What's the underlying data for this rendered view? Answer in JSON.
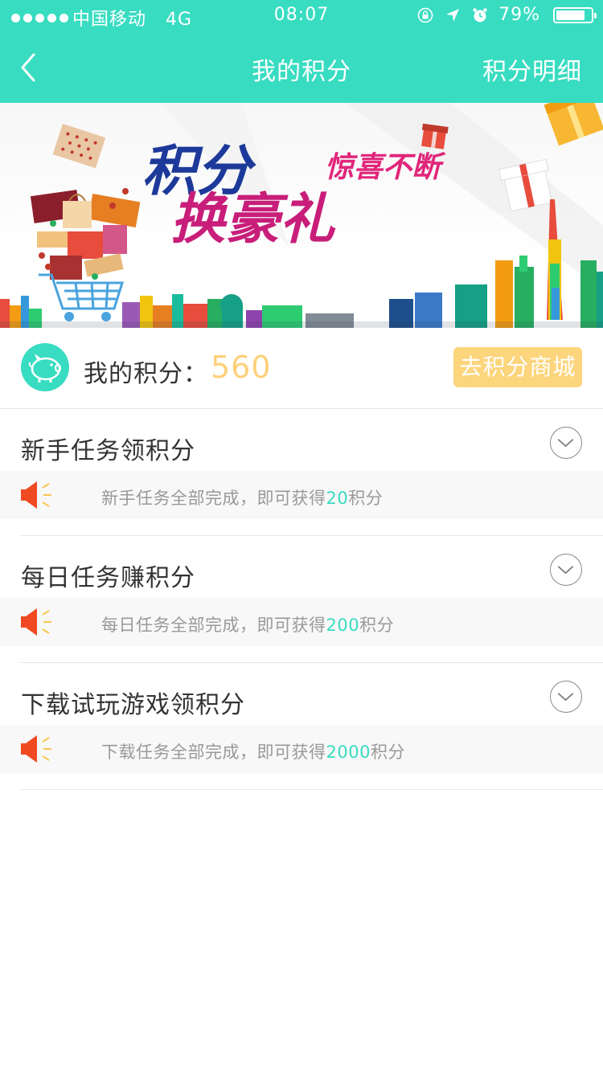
{
  "status_bar": {
    "carrier": "中国移动",
    "network": "4G",
    "time": "08:07",
    "battery": "79%",
    "icons": [
      "signal-dots-icon",
      "rotation-lock-icon",
      "location-arrow-icon",
      "alarm-icon",
      "battery-icon"
    ]
  },
  "nav": {
    "title": "我的积分",
    "right_link": "积分明细",
    "back_icon": "chevron-left-icon"
  },
  "banner": {
    "text_line1": "积分",
    "text_slogan": "惊喜不断",
    "text_line2": "换豪礼"
  },
  "points": {
    "label": "我的积分：",
    "value": "560",
    "button": "去积分商城",
    "icon": "piggy-bank-icon"
  },
  "tasks": [
    {
      "title": "新手任务领积分",
      "desc_prefix": "新手任务全部完成，即可获得",
      "desc_points": "20",
      "desc_suffix": "积分"
    },
    {
      "title": "每日任务赚积分",
      "desc_prefix": "每日任务全部完成，即可获得",
      "desc_points": "200",
      "desc_suffix": "积分"
    },
    {
      "title": "下载试玩游戏领积分",
      "desc_prefix": "下载任务全部完成，即可获得",
      "desc_points": "2000",
      "desc_suffix": "积分"
    }
  ],
  "colors": {
    "brand": "#38dcc1",
    "points_value": "#fdd07a",
    "mall_button": "#fcd57c",
    "speaker": "#f04a23"
  }
}
